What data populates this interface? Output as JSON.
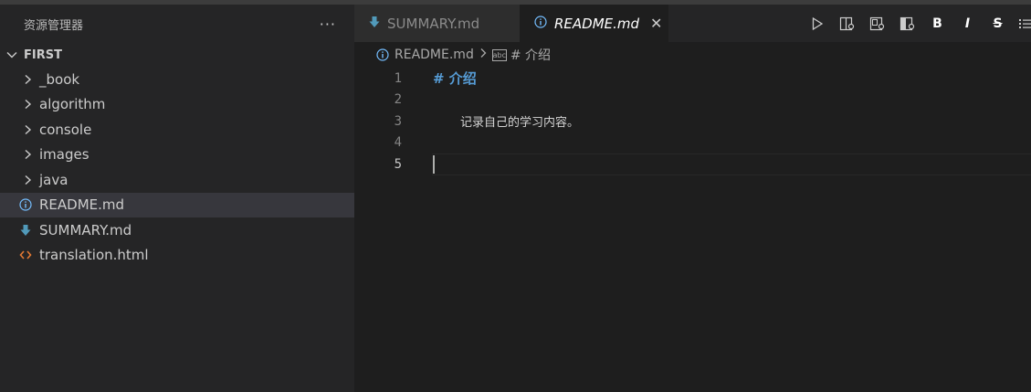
{
  "sidebar": {
    "title": "资源管理器",
    "more": "···",
    "folder": "FIRST",
    "items": [
      {
        "label": "_book",
        "type": "folder"
      },
      {
        "label": "algorithm",
        "type": "folder"
      },
      {
        "label": "console",
        "type": "folder"
      },
      {
        "label": "images",
        "type": "folder"
      },
      {
        "label": "java",
        "type": "folder"
      },
      {
        "label": "README.md",
        "type": "info-file",
        "selected": true
      },
      {
        "label": "SUMMARY.md",
        "type": "download-file"
      },
      {
        "label": "translation.html",
        "type": "html-file"
      }
    ]
  },
  "tabs": [
    {
      "label": "SUMMARY.md",
      "icon": "download-arrow-icon",
      "active": false
    },
    {
      "label": "README.md",
      "icon": "info-icon",
      "active": true,
      "close": "✕"
    }
  ],
  "toolbar": {
    "bold": "B",
    "italic": "I",
    "strike": "S"
  },
  "breadcrumb": {
    "file": "README.md",
    "symbol_icon": "abc",
    "symbol": "# 介绍"
  },
  "editor": {
    "lines": [
      {
        "num": "1",
        "text": "# 介绍"
      },
      {
        "num": "2",
        "text": ""
      },
      {
        "num": "3",
        "text": "记录自己的学习内容。"
      },
      {
        "num": "4",
        "text": ""
      },
      {
        "num": "5",
        "text": ""
      }
    ]
  },
  "colors": {
    "heading": "#569cd6",
    "selected_row": "#37373d",
    "info_icon": "#75beff",
    "download_icon": "#519aba",
    "html_icon": "#e37933"
  }
}
